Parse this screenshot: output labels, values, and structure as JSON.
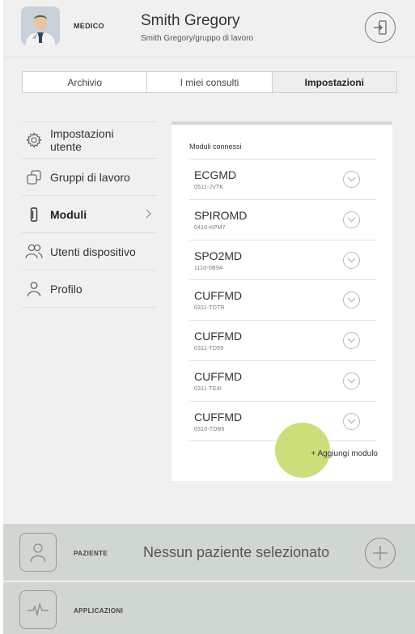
{
  "header": {
    "role": "MEDICO",
    "name": "Smith Gregory",
    "subname": "Smith Gregory/gruppo di lavoro",
    "avatar_icon": "doctor-avatar",
    "logout_icon": "logout-icon"
  },
  "tabs": [
    {
      "label": "Archivio",
      "active": false
    },
    {
      "label": "I miei consulti",
      "active": false
    },
    {
      "label": "Impostazioni",
      "active": true
    }
  ],
  "sidebar": {
    "items": [
      {
        "label": "Impostazioni utente",
        "icon": "gear-icon",
        "active": false
      },
      {
        "label": "Gruppi di lavoro",
        "icon": "groups-icon",
        "active": false
      },
      {
        "label": "Moduli",
        "icon": "module-icon",
        "active": true
      },
      {
        "label": "Utenti dispositivo",
        "icon": "users-icon",
        "active": false
      },
      {
        "label": "Profilo",
        "icon": "person-icon",
        "active": false
      }
    ]
  },
  "modules_panel": {
    "title": "Moduli connessi",
    "modules": [
      {
        "name": "ECGMD",
        "code": "0511-JVTK"
      },
      {
        "name": "SPIROMD",
        "code": "0410-KPM7"
      },
      {
        "name": "SPO2MD",
        "code": "1110-0B9A"
      },
      {
        "name": "CUFFMD",
        "code": "0311-TDTR"
      },
      {
        "name": "CUFFMD",
        "code": "0311-TD59"
      },
      {
        "name": "CUFFMD",
        "code": "0311-TE4I"
      },
      {
        "name": "CUFFMD",
        "code": "0310-TDB6"
      }
    ],
    "add_label": "+ Aggiungi modulo"
  },
  "bottom": {
    "patient_label": "PAZIENTE",
    "patient_text": "Nessun paziente selezionato",
    "apps_label": "APPLICAZIONI"
  },
  "colors": {
    "accent_touch": "#c7dc72",
    "bottom_bar": "#d0d6d0",
    "background": "#f0f0f0"
  }
}
